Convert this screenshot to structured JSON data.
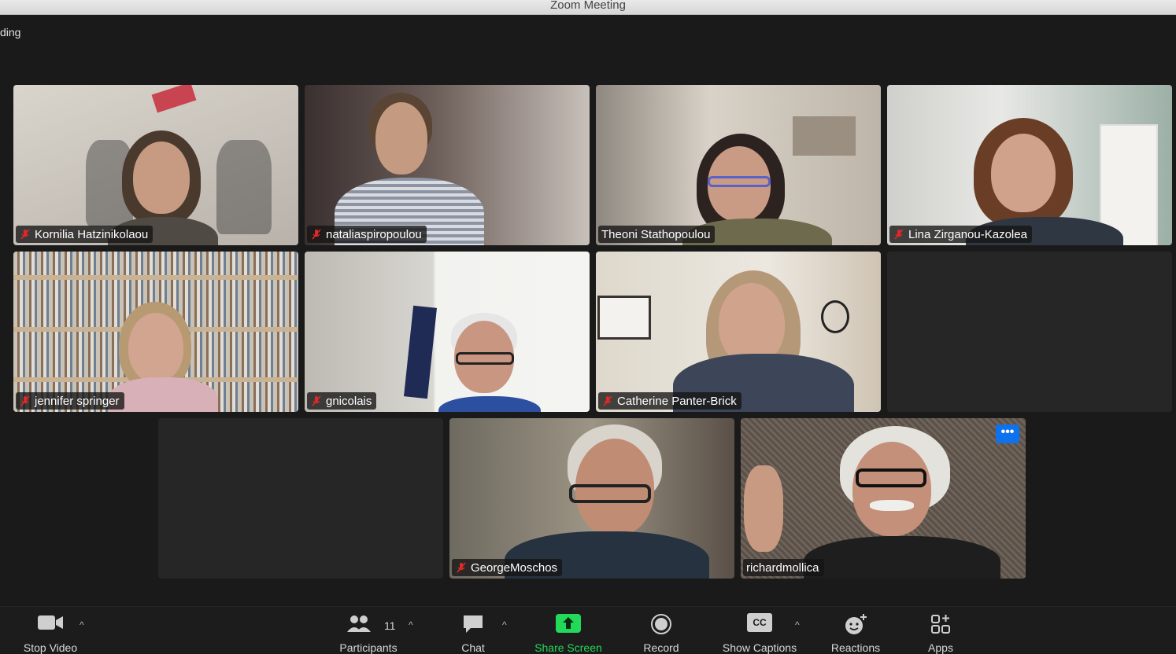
{
  "window": {
    "title": "Zoom Meeting",
    "view_label": "ding"
  },
  "participants": [
    {
      "name": "Kornilia Hatzinikolaou",
      "muted": true,
      "video": true
    },
    {
      "name": "nataliaspiropoulou",
      "muted": true,
      "video": true
    },
    {
      "name": "Theoni Stathopoulou",
      "muted": false,
      "video": true
    },
    {
      "name": "Lina Zirganou-Kazolea",
      "muted": true,
      "video": true
    },
    {
      "name": "jennifer springer",
      "muted": true,
      "video": true
    },
    {
      "name": "gnicolais",
      "muted": true,
      "video": true
    },
    {
      "name": "Catherine Panter-Brick",
      "muted": true,
      "video": true
    },
    {
      "name": "",
      "muted": false,
      "video": false
    },
    {
      "name": "",
      "muted": false,
      "video": false
    },
    {
      "name": "GeorgeMoschos",
      "muted": true,
      "video": true
    },
    {
      "name": "richardmollica",
      "muted": false,
      "video": true,
      "active_speaker": true
    }
  ],
  "toolbar": {
    "stop_video": "Stop Video",
    "participants": "Participants",
    "participants_count": "11",
    "chat": "Chat",
    "share_screen": "Share Screen",
    "record": "Record",
    "show_captions": "Show Captions",
    "captions_icon_text": "CC",
    "reactions": "Reactions",
    "apps": "Apps",
    "more_dots": "•••"
  },
  "colors": {
    "accent_green": "#23d959",
    "muted_red": "#e02828",
    "more_blue": "#0e72ed"
  }
}
